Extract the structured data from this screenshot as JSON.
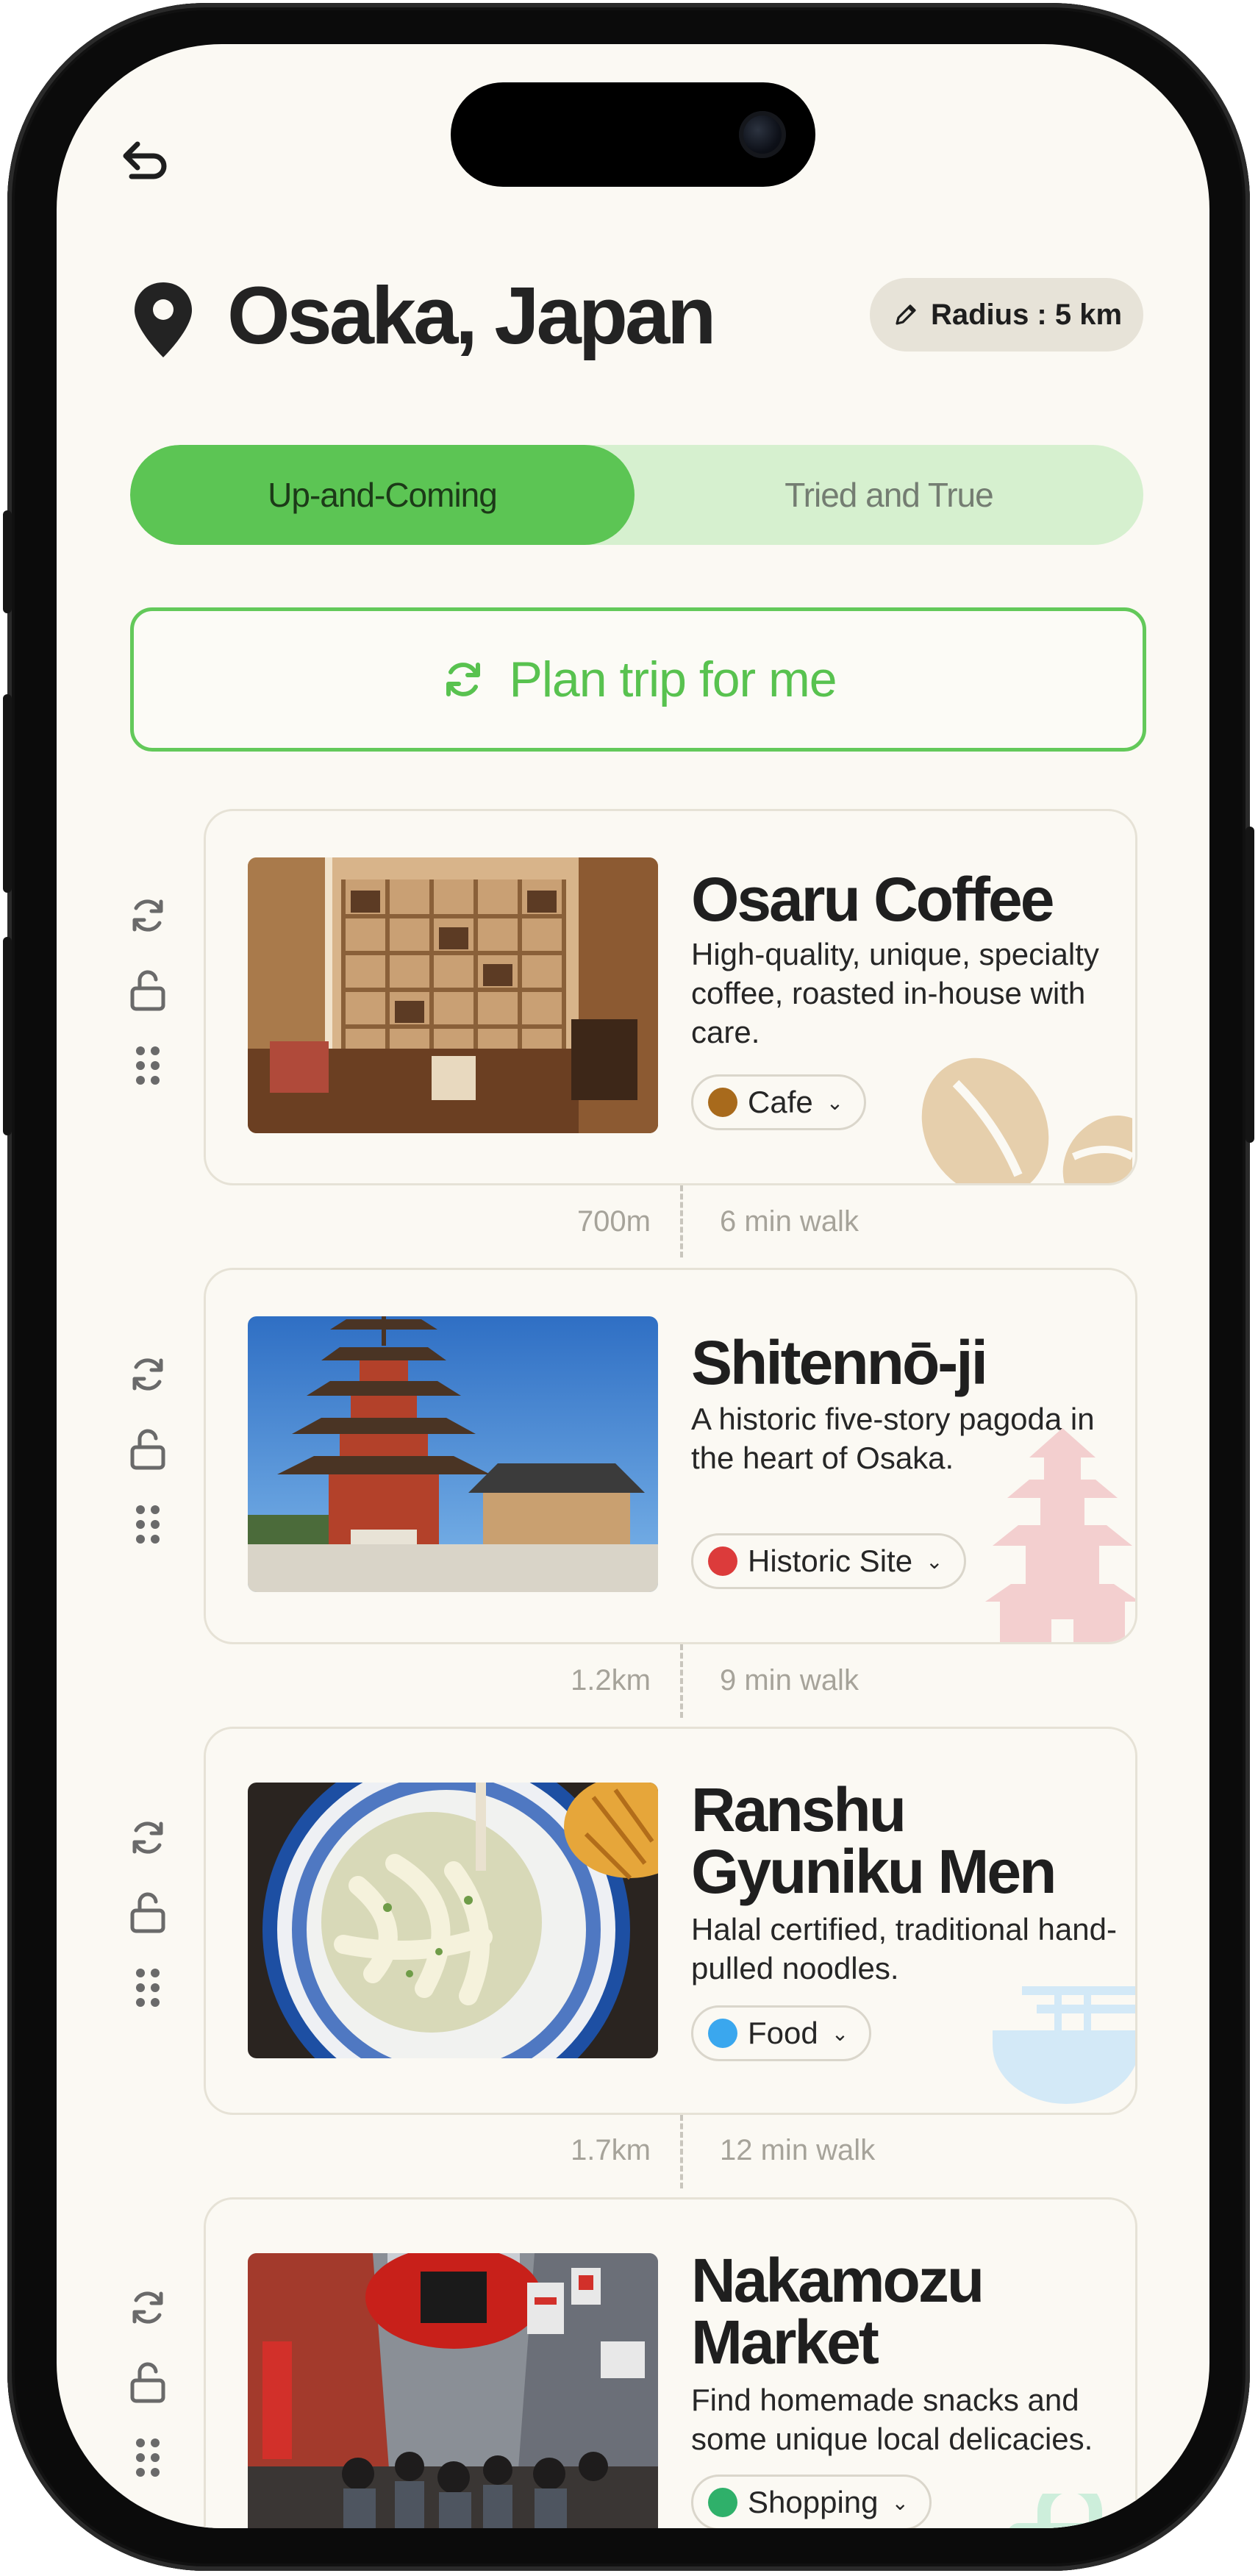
{
  "header": {
    "city": "Osaka, Japan",
    "radius_label": "Radius : 5 km"
  },
  "tabs": [
    {
      "label": "Up-and-Coming",
      "active": true
    },
    {
      "label": "Tried and True",
      "active": false
    }
  ],
  "plan_button": {
    "label": "Plan trip for me"
  },
  "places": [
    {
      "name": "Osaru Coffee",
      "description": "High-quality, unique, specialty coffee, roasted in-house with care.",
      "category": "Cafe",
      "category_color": "#a86a1c"
    },
    {
      "name": "Shitennō-ji",
      "description": "A historic five-story pagoda in the heart of Osaka.",
      "category": "Historic Site",
      "category_color": "#dc3b3b"
    },
    {
      "name": "Ranshu Gyuniku Men",
      "description": "Halal certified, traditional hand-pulled noodles.",
      "category": "Food",
      "category_color": "#3aa7ee"
    },
    {
      "name": "Nakamozu Market",
      "description": "Find homemade snacks and some unique local delicacies.",
      "category": "Shopping",
      "category_color": "#2fb06a"
    }
  ],
  "connections": [
    {
      "distance": "700m",
      "walk": "6 min walk"
    },
    {
      "distance": "1.2km",
      "walk": "9 min walk"
    },
    {
      "distance": "1.7km",
      "walk": "12 min walk"
    }
  ],
  "icons": {
    "back": "back-arrow-icon",
    "location": "location-pin-icon",
    "edit": "pencil-icon",
    "plan": "refresh-icon",
    "reroll": "refresh-icon",
    "lock": "unlock-icon",
    "drag": "drag-handle-icon"
  },
  "colors": {
    "accent": "#5cc554",
    "accent_light": "#d6f0cf",
    "background": "#fbf9f3"
  }
}
